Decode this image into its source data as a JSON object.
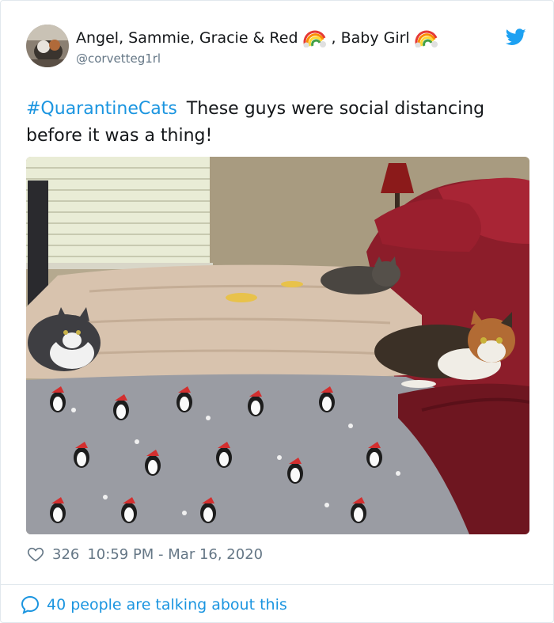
{
  "tweet": {
    "display_name": "Angel, Sammie, Gracie & Red",
    "display_name_sep": ", Baby Girl",
    "handle": "@corvetteg1rl",
    "hashtag": "#QuarantineCats",
    "body": "These guys were social distancing before it was a thing!",
    "likes": "326",
    "timestamp": "10:59 PM - Mar 16, 2020",
    "talking": "40 people are talking about this"
  },
  "colors": {
    "link": "#1b95e0",
    "muted": "#657786",
    "text": "#14171a"
  },
  "icons": {
    "avatar": "avatar-photo",
    "emoji": "rainbow-icon",
    "brand": "twitter-bird-icon",
    "like": "heart-icon",
    "reply": "speech-bubble-icon"
  }
}
